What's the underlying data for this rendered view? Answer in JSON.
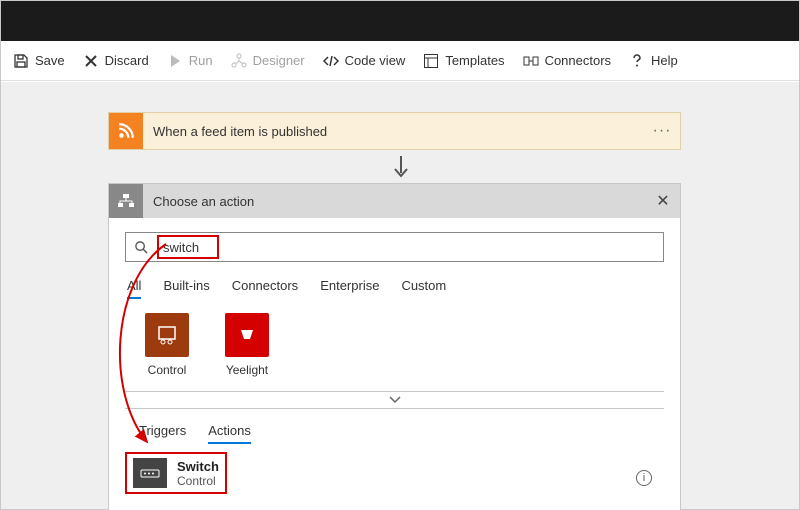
{
  "toolbar": {
    "save": "Save",
    "discard": "Discard",
    "run": "Run",
    "designer": "Designer",
    "codeview": "Code view",
    "templates": "Templates",
    "connectors": "Connectors",
    "help": "Help"
  },
  "trigger": {
    "title": "When a feed item is published"
  },
  "panel": {
    "title": "Choose an action",
    "search_value": "switch",
    "tabs1": [
      "All",
      "Built-ins",
      "Connectors",
      "Enterprise",
      "Custom"
    ],
    "connectors": [
      {
        "label": "Control"
      },
      {
        "label": "Yeelight"
      }
    ],
    "tabs2": [
      "Triggers",
      "Actions"
    ],
    "result": {
      "title": "Switch",
      "subtitle": "Control"
    }
  }
}
